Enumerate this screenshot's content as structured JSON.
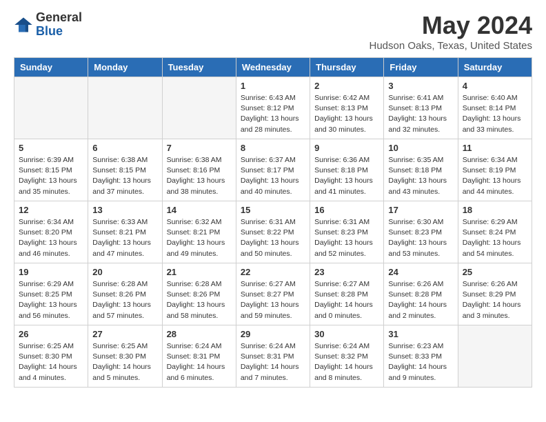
{
  "logo": {
    "general": "General",
    "blue": "Blue"
  },
  "title": "May 2024",
  "location": "Hudson Oaks, Texas, United States",
  "weekdays": [
    "Sunday",
    "Monday",
    "Tuesday",
    "Wednesday",
    "Thursday",
    "Friday",
    "Saturday"
  ],
  "weeks": [
    [
      {
        "day": "",
        "info": ""
      },
      {
        "day": "",
        "info": ""
      },
      {
        "day": "",
        "info": ""
      },
      {
        "day": "1",
        "info": "Sunrise: 6:43 AM\nSunset: 8:12 PM\nDaylight: 13 hours\nand 28 minutes."
      },
      {
        "day": "2",
        "info": "Sunrise: 6:42 AM\nSunset: 8:13 PM\nDaylight: 13 hours\nand 30 minutes."
      },
      {
        "day": "3",
        "info": "Sunrise: 6:41 AM\nSunset: 8:13 PM\nDaylight: 13 hours\nand 32 minutes."
      },
      {
        "day": "4",
        "info": "Sunrise: 6:40 AM\nSunset: 8:14 PM\nDaylight: 13 hours\nand 33 minutes."
      }
    ],
    [
      {
        "day": "5",
        "info": "Sunrise: 6:39 AM\nSunset: 8:15 PM\nDaylight: 13 hours\nand 35 minutes."
      },
      {
        "day": "6",
        "info": "Sunrise: 6:38 AM\nSunset: 8:15 PM\nDaylight: 13 hours\nand 37 minutes."
      },
      {
        "day": "7",
        "info": "Sunrise: 6:38 AM\nSunset: 8:16 PM\nDaylight: 13 hours\nand 38 minutes."
      },
      {
        "day": "8",
        "info": "Sunrise: 6:37 AM\nSunset: 8:17 PM\nDaylight: 13 hours\nand 40 minutes."
      },
      {
        "day": "9",
        "info": "Sunrise: 6:36 AM\nSunset: 8:18 PM\nDaylight: 13 hours\nand 41 minutes."
      },
      {
        "day": "10",
        "info": "Sunrise: 6:35 AM\nSunset: 8:18 PM\nDaylight: 13 hours\nand 43 minutes."
      },
      {
        "day": "11",
        "info": "Sunrise: 6:34 AM\nSunset: 8:19 PM\nDaylight: 13 hours\nand 44 minutes."
      }
    ],
    [
      {
        "day": "12",
        "info": "Sunrise: 6:34 AM\nSunset: 8:20 PM\nDaylight: 13 hours\nand 46 minutes."
      },
      {
        "day": "13",
        "info": "Sunrise: 6:33 AM\nSunset: 8:21 PM\nDaylight: 13 hours\nand 47 minutes."
      },
      {
        "day": "14",
        "info": "Sunrise: 6:32 AM\nSunset: 8:21 PM\nDaylight: 13 hours\nand 49 minutes."
      },
      {
        "day": "15",
        "info": "Sunrise: 6:31 AM\nSunset: 8:22 PM\nDaylight: 13 hours\nand 50 minutes."
      },
      {
        "day": "16",
        "info": "Sunrise: 6:31 AM\nSunset: 8:23 PM\nDaylight: 13 hours\nand 52 minutes."
      },
      {
        "day": "17",
        "info": "Sunrise: 6:30 AM\nSunset: 8:23 PM\nDaylight: 13 hours\nand 53 minutes."
      },
      {
        "day": "18",
        "info": "Sunrise: 6:29 AM\nSunset: 8:24 PM\nDaylight: 13 hours\nand 54 minutes."
      }
    ],
    [
      {
        "day": "19",
        "info": "Sunrise: 6:29 AM\nSunset: 8:25 PM\nDaylight: 13 hours\nand 56 minutes."
      },
      {
        "day": "20",
        "info": "Sunrise: 6:28 AM\nSunset: 8:26 PM\nDaylight: 13 hours\nand 57 minutes."
      },
      {
        "day": "21",
        "info": "Sunrise: 6:28 AM\nSunset: 8:26 PM\nDaylight: 13 hours\nand 58 minutes."
      },
      {
        "day": "22",
        "info": "Sunrise: 6:27 AM\nSunset: 8:27 PM\nDaylight: 13 hours\nand 59 minutes."
      },
      {
        "day": "23",
        "info": "Sunrise: 6:27 AM\nSunset: 8:28 PM\nDaylight: 14 hours\nand 0 minutes."
      },
      {
        "day": "24",
        "info": "Sunrise: 6:26 AM\nSunset: 8:28 PM\nDaylight: 14 hours\nand 2 minutes."
      },
      {
        "day": "25",
        "info": "Sunrise: 6:26 AM\nSunset: 8:29 PM\nDaylight: 14 hours\nand 3 minutes."
      }
    ],
    [
      {
        "day": "26",
        "info": "Sunrise: 6:25 AM\nSunset: 8:30 PM\nDaylight: 14 hours\nand 4 minutes."
      },
      {
        "day": "27",
        "info": "Sunrise: 6:25 AM\nSunset: 8:30 PM\nDaylight: 14 hours\nand 5 minutes."
      },
      {
        "day": "28",
        "info": "Sunrise: 6:24 AM\nSunset: 8:31 PM\nDaylight: 14 hours\nand 6 minutes."
      },
      {
        "day": "29",
        "info": "Sunrise: 6:24 AM\nSunset: 8:31 PM\nDaylight: 14 hours\nand 7 minutes."
      },
      {
        "day": "30",
        "info": "Sunrise: 6:24 AM\nSunset: 8:32 PM\nDaylight: 14 hours\nand 8 minutes."
      },
      {
        "day": "31",
        "info": "Sunrise: 6:23 AM\nSunset: 8:33 PM\nDaylight: 14 hours\nand 9 minutes."
      },
      {
        "day": "",
        "info": ""
      }
    ]
  ]
}
